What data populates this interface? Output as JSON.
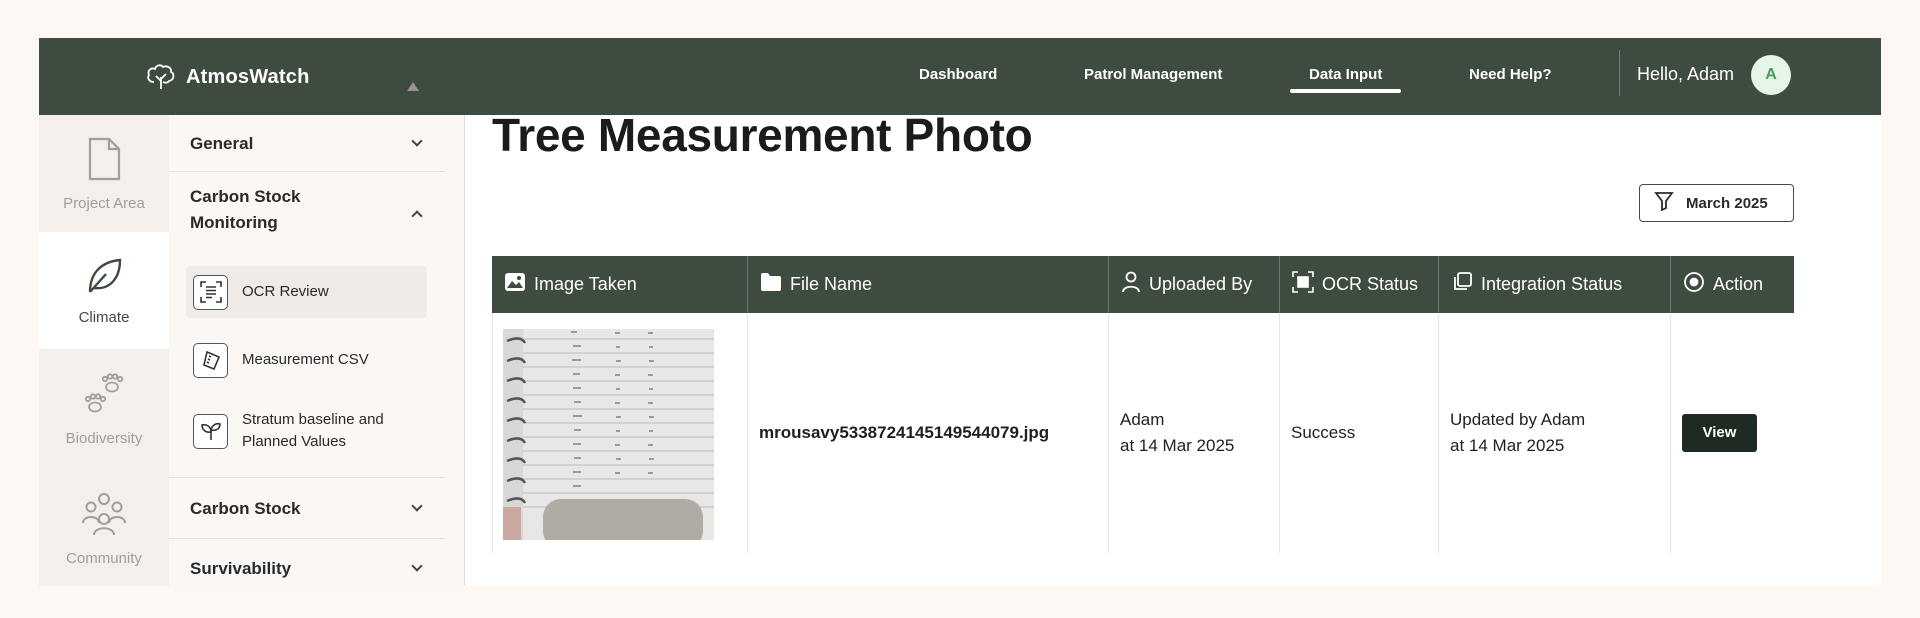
{
  "header": {
    "brand": "AtmosWatch",
    "nav": [
      "Dashboard",
      "Patrol Management",
      "Data Input",
      "Need Help?"
    ],
    "active_nav": "Data Input",
    "greeting": "Hello, Adam",
    "avatar_initial": "A"
  },
  "rail": {
    "project_area": "Project Area",
    "climate": "Climate",
    "biodiversity": "Biodiversity",
    "community": "Community",
    "active": "Climate"
  },
  "submenu": {
    "general": "General",
    "carbon_stock_monitoring": "Carbon Stock Monitoring",
    "items": [
      {
        "label": "OCR Review",
        "active": true
      },
      {
        "label": "Measurement CSV",
        "active": false
      },
      {
        "label": "Stratum baseline and Planned Values",
        "active": false
      }
    ],
    "carbon_stock": "Carbon Stock",
    "survivability": "Survivability"
  },
  "main": {
    "title": "Tree Measurement Photo",
    "filter_label": "March 2025"
  },
  "table": {
    "headers": [
      "Image Taken",
      "File Name",
      "Uploaded By",
      "OCR Status",
      "Integration Status",
      "Action"
    ],
    "rows": [
      {
        "file_name": "mrousavy5338724145149544079.jpg",
        "uploaded_by": "Adam",
        "uploaded_at": "at 14 Mar 2025",
        "ocr_status": "Success",
        "integration_by": "Updated by Adam",
        "integration_at": "at 14 Mar 2025",
        "action": "View"
      }
    ]
  },
  "colors": {
    "primary": "#3e4c3f",
    "button_dark": "#1f2a22",
    "background": "#fdf8f4"
  }
}
